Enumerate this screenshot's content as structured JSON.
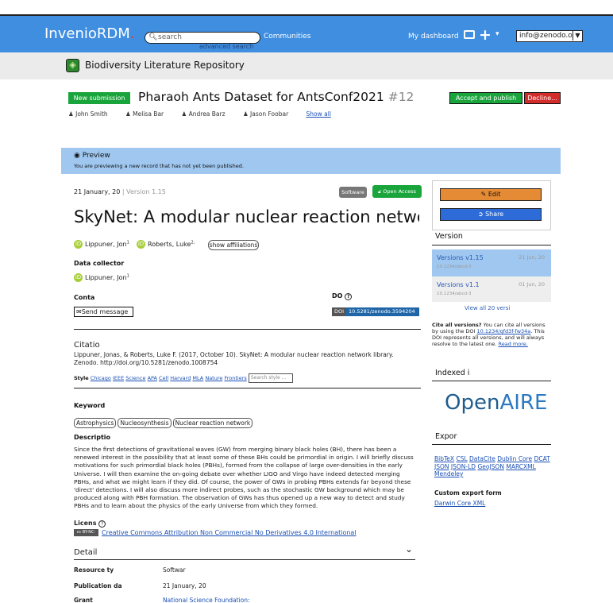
{
  "header": {
    "brand": "InvenioRDM",
    "search_placeholder": "search",
    "advanced_search": "advanced search",
    "communities": "Communities",
    "dashboard": "My dashboard",
    "user": "info@zenodo.org"
  },
  "community": {
    "name": "Biodiversity Literature Repository"
  },
  "submission": {
    "badge": "New submission",
    "title": "Pharaoh Ants Dataset for AntsConf2021",
    "number": "#12",
    "accept": "Accept and publish",
    "decline": "Decline...",
    "authors": [
      "John Smith",
      "Melisa Bar",
      "Andrea Barz",
      "Jason Foobar"
    ],
    "show_all": "Show all"
  },
  "preview": {
    "heading": "Preview",
    "text": "You are previewing a new record that has not yet been published."
  },
  "record": {
    "date": "21 January, 20",
    "version": "| Version 1.15",
    "type_badge": "Software",
    "access_badge": "Open Access",
    "title": "SkyNet: A modular nuclear reaction network l",
    "author1": "Lippuner, Jon",
    "author1_sup": "1",
    "author2": "Roberts, Luke",
    "author2_sup": "2,",
    "show_affiliations": "show affiliations",
    "data_collector_label": "Data collector",
    "collector": "Lippuner, Jon",
    "collector_sup": "1",
    "contact_label": "Conta",
    "doi_label": "DO",
    "send_message": "Send message",
    "doi_key": "DOI",
    "doi_value": "10.5281/zenodo.3594204",
    "citation_title": "Citatio",
    "citation_text": "Lippuner, Jonas, & Roberts, Luke F. (2017, October 10). SkyNet: A modular nuclear reaction network library. Zenodo. http://doi.org/10.5281/zenodo.1008754",
    "style_label": "Style",
    "styles": [
      "Chicago",
      "IEEE",
      "Science",
      "APA",
      "Cell",
      "Harvard",
      "MLA",
      "Nature",
      "Frontiers"
    ],
    "style_search": "Search style ...",
    "keywords_label": "Keyword",
    "keywords": [
      "Astrophysics",
      "Nucleosynthesis",
      "Nuclear reaction network"
    ],
    "description_label": "Descriptio",
    "description": "Since the first detections of gravitational waves (GW) from merging binary black holes (BH), there has been a renewed interest in the possibility that at least some of these BHs could be primordial in origin. I will briefly discuss motivations for such primordial black holes (PBHs), formed from the collapse of large over-densities in the early Universe. I will then examine the on-going debate over whether LIGO and Virgo have indeed detected merging PBHs, and what we might learn if they did. Of course, the power of GWs in probing PBHs extends far beyond these 'direct' detections. I will also discuss more indirect probes, such as the stochastic GW background which may be produced along with PBH formation. The observation of GWs has thus opened up a new way to detect and study PBHs and to learn about the physics of the early Universe from which they formed.",
    "license_label": "Licens",
    "license_badge": "cc BY-NC-ND",
    "license": "Creative Commons Attribution Non Commercial No Derivatives 4.0 International",
    "details_label": "Detail",
    "details": [
      {
        "k": "Resource ty",
        "v": "Softwar"
      },
      {
        "k": "Publication da",
        "v": "21 January, 20"
      },
      {
        "k": "Grant",
        "v": "National Science Foundation:"
      }
    ]
  },
  "sidebar": {
    "edit": "Edit",
    "share": "Share",
    "version_title": "Version",
    "versions": [
      {
        "name": "Versions v1.15",
        "date": "21 Jun, 20",
        "doi": "10.1234/abcd-3"
      },
      {
        "name": "Versions v1.1",
        "date": "01 Jun, 20",
        "doi": "10.1234/abcd-3"
      }
    ],
    "view_all": "View all 20 versi",
    "cite_all_bold": "Cite all versions?",
    "cite_all_text": " You can cite all versions by using the DOI ",
    "cite_all_doi": "10.1234/qfd3f-fw34a",
    "cite_all_text2": ". This DOI represents all versions, and will always resolve to the latest one. ",
    "read_more": "Read more.",
    "indexed_title": "Indexed i",
    "openaire_a": "Open",
    "openaire_b": "AIRE",
    "export_title": "Expor",
    "export_links": [
      "BibTeX",
      "CSL",
      "DataCite",
      "Dublin Core",
      "DCAT",
      "JSON",
      "JSON-LD",
      "GeoJSON",
      "MARCXML",
      "Mendeley"
    ],
    "custom_export": "Custom export form",
    "darwin": "Darwin Core XML"
  }
}
